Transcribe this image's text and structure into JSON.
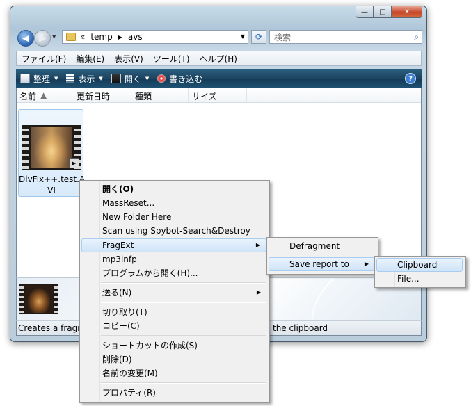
{
  "window": {
    "controls": {
      "minimize": "—",
      "maximize": "□",
      "close": "✕"
    },
    "address": {
      "prefix": "«",
      "segments": [
        "temp",
        "avs"
      ]
    },
    "search_placeholder": "検索",
    "menubar": [
      "ファイル(F)",
      "編集(E)",
      "表示(V)",
      "ツール(T)",
      "ヘルプ(H)"
    ],
    "commands": [
      {
        "label": "整理",
        "icon": "organize-icon"
      },
      {
        "label": "表示",
        "icon": "views-icon"
      },
      {
        "label": "開く",
        "icon": "open-icon"
      },
      {
        "label": "書き込む",
        "icon": "burn-icon"
      }
    ],
    "columns": [
      "名前",
      "更新日時",
      "種類",
      "サイズ"
    ],
    "file": {
      "name_line1": "DivFix++.test.A",
      "name_line2": "VI"
    },
    "status_left": "Creates a fragme",
    "status_right": "the clipboard"
  },
  "context_menu": {
    "items": [
      "開く(O)",
      "MassReset...",
      "New Folder Here",
      "Scan using Spybot-Search&Destroy",
      "FragExt",
      "mp3infp",
      "プログラムから開く(H)...",
      "送る(N)",
      "切り取り(T)",
      "コピー(C)",
      "ショートカットの作成(S)",
      "削除(D)",
      "名前の変更(M)",
      "プロパティ(R)"
    ]
  },
  "submenu_fragext": {
    "items": [
      "Defragment",
      "Save report to"
    ]
  },
  "submenu_save": {
    "items": [
      "Clipboard",
      "File..."
    ]
  }
}
